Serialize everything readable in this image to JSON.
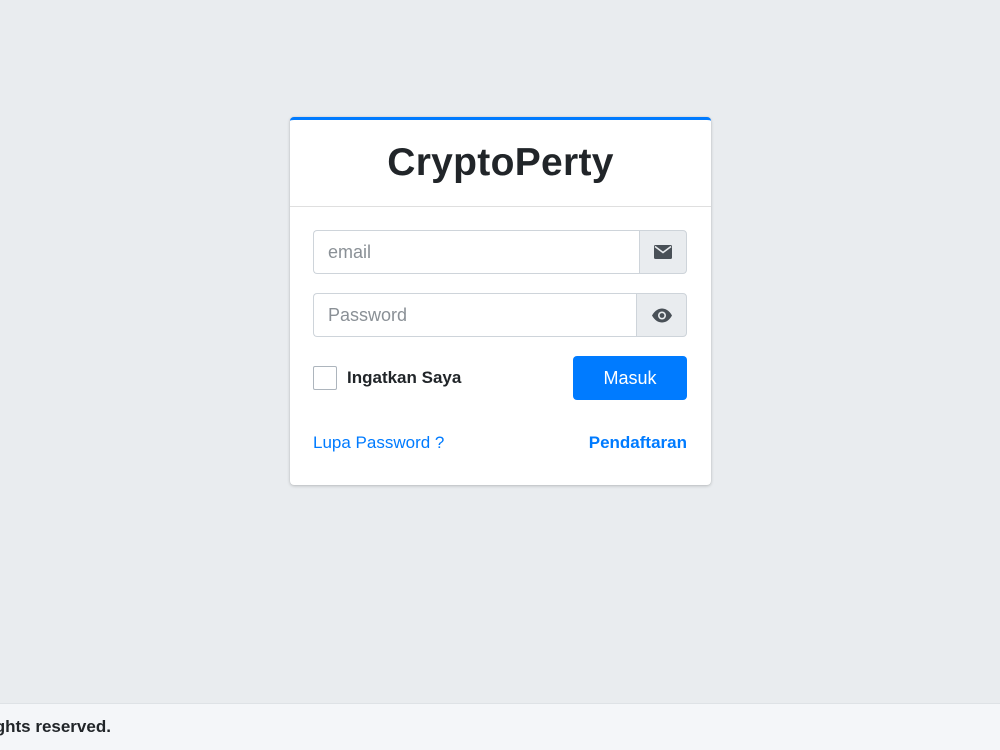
{
  "brand": {
    "title": "CryptoPerty"
  },
  "login": {
    "email_placeholder": "email",
    "password_placeholder": "Password",
    "remember_label": "Ingatkan Saya",
    "submit_label": "Masuk",
    "forgot_link": "Lupa Password ?",
    "register_link": "Pendaftaran",
    "email_icon": "envelope-icon",
    "password_icon": "eye-icon"
  },
  "footer": {
    "text": "ights reserved."
  },
  "colors": {
    "accent": "#007bff",
    "background": "#e9ecef",
    "card": "#ffffff",
    "text": "#212529"
  }
}
